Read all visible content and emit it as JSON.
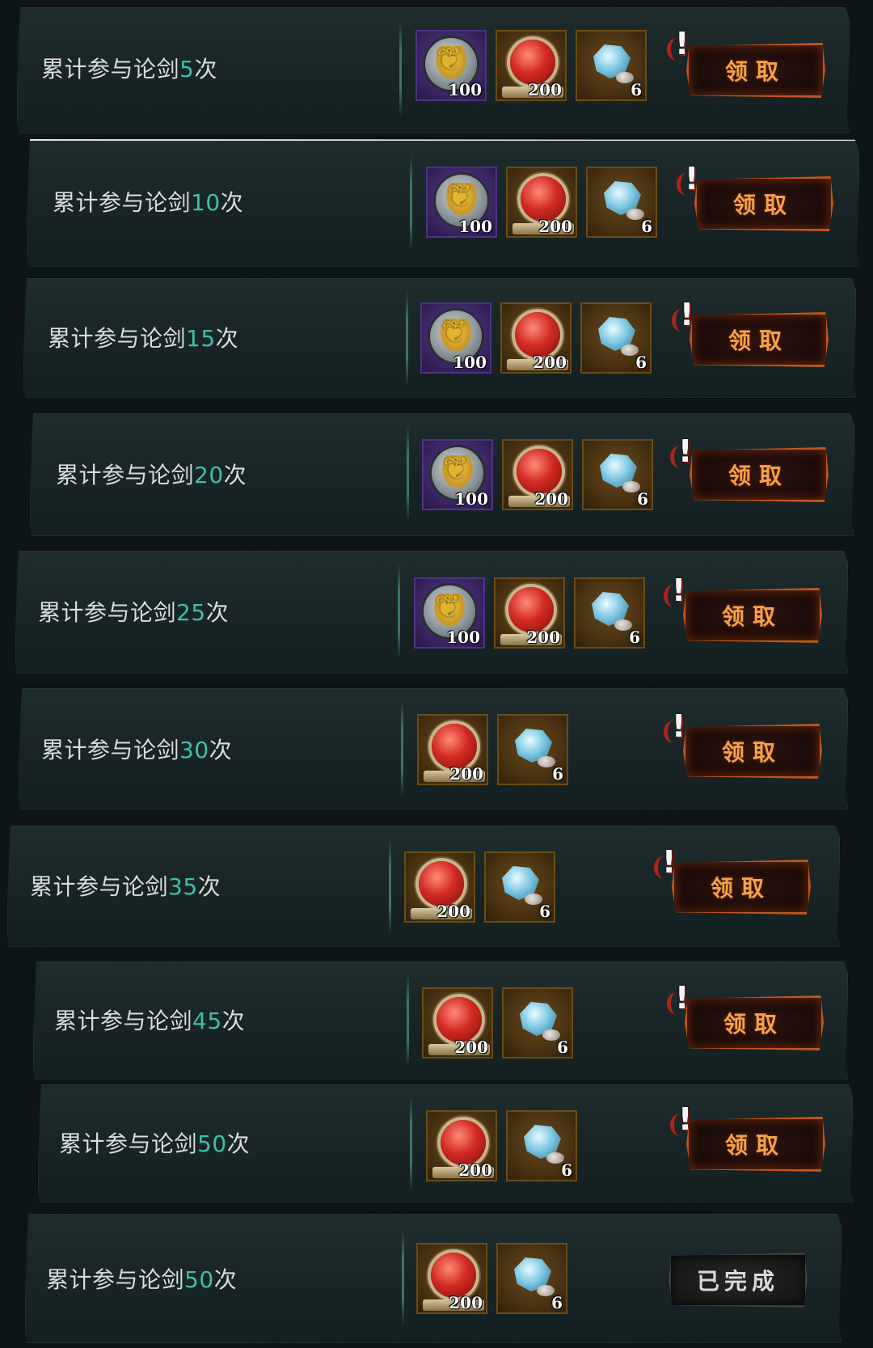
{
  "rows": [
    {
      "prefix": "累计参与论剑",
      "count": "5",
      "suffix": "次",
      "items": [
        {
          "type": "emblem",
          "qty": "100"
        },
        {
          "type": "medal",
          "qty": "200"
        },
        {
          "type": "gem",
          "qty": "6"
        }
      ],
      "button": "领取",
      "state": "claimable"
    },
    {
      "prefix": "累计参与论剑",
      "count": "10",
      "suffix": "次",
      "items": [
        {
          "type": "emblem",
          "qty": "100"
        },
        {
          "type": "medal",
          "qty": "200"
        },
        {
          "type": "gem",
          "qty": "6"
        }
      ],
      "button": "领取",
      "state": "claimable"
    },
    {
      "prefix": "累计参与论剑",
      "count": "15",
      "suffix": "次",
      "items": [
        {
          "type": "emblem",
          "qty": "100"
        },
        {
          "type": "medal",
          "qty": "200"
        },
        {
          "type": "gem",
          "qty": "6"
        }
      ],
      "button": "领取",
      "state": "claimable"
    },
    {
      "prefix": "累计参与论剑",
      "count": "20",
      "suffix": "次",
      "items": [
        {
          "type": "emblem",
          "qty": "100"
        },
        {
          "type": "medal",
          "qty": "200"
        },
        {
          "type": "gem",
          "qty": "6"
        }
      ],
      "button": "领取",
      "state": "claimable"
    },
    {
      "prefix": "累计参与论剑",
      "count": "25",
      "suffix": "次",
      "items": [
        {
          "type": "emblem",
          "qty": "100"
        },
        {
          "type": "medal",
          "qty": "200"
        },
        {
          "type": "gem",
          "qty": "6"
        }
      ],
      "button": "领取",
      "state": "claimable"
    },
    {
      "prefix": "累计参与论剑",
      "count": "30",
      "suffix": "次",
      "items": [
        {
          "type": "medal",
          "qty": "200"
        },
        {
          "type": "gem",
          "qty": "6"
        }
      ],
      "button": "领取",
      "state": "claimable"
    },
    {
      "prefix": "累计参与论剑",
      "count": "35",
      "suffix": "次",
      "items": [
        {
          "type": "medal",
          "qty": "200"
        },
        {
          "type": "gem",
          "qty": "6"
        }
      ],
      "button": "领取",
      "state": "claimable"
    },
    {
      "prefix": "累计参与论剑",
      "count": "45",
      "suffix": "次",
      "items": [
        {
          "type": "medal",
          "qty": "200"
        },
        {
          "type": "gem",
          "qty": "6"
        }
      ],
      "button": "领取",
      "state": "claimable"
    },
    {
      "prefix": "累计参与论剑",
      "count": "50",
      "suffix": "次",
      "items": [
        {
          "type": "medal",
          "qty": "200"
        },
        {
          "type": "gem",
          "qty": "6"
        }
      ],
      "button": "领取",
      "state": "claimable"
    },
    {
      "prefix": "累计参与论剑",
      "count": "50",
      "suffix": "次",
      "items": [
        {
          "type": "medal",
          "qty": "200"
        },
        {
          "type": "gem",
          "qty": "6"
        }
      ],
      "button": "已完成",
      "state": "completed"
    }
  ],
  "colors": {
    "count_accent": "#3fbfa8",
    "claim_glow": "#f2a34a"
  },
  "icons": {
    "emblem": "gold-antler-emblem-icon",
    "medal": "red-medal-icon",
    "gem": "blue-gem-icon",
    "alert": "exclamation-alert-icon"
  }
}
